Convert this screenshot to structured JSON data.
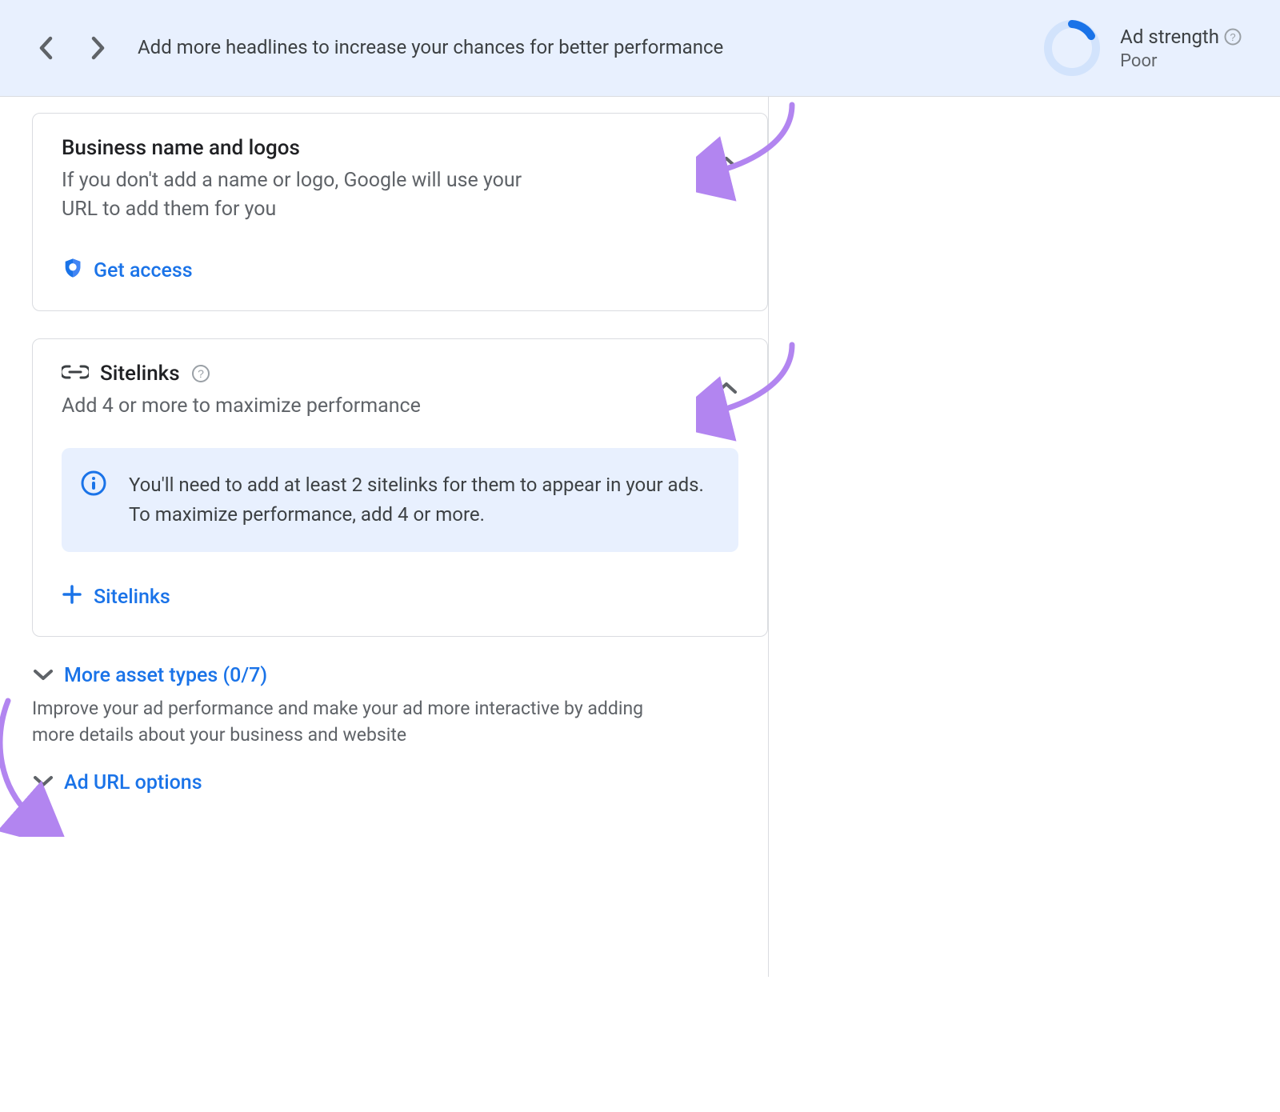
{
  "header": {
    "tip_text": "Add more headlines to increase your chances for better performance",
    "ad_strength_label": "Ad strength",
    "ad_strength_value": "Poor"
  },
  "card_business": {
    "title": "Business name and logos",
    "subtitle": "If you don't add a name or logo, Google will use your URL to add them for you",
    "get_access_label": "Get access"
  },
  "card_sitelinks": {
    "title": "Sitelinks",
    "subtitle": "Add 4 or more to maximize performance",
    "info_text": "You'll need to add at least 2 sitelinks for them to appear in your ads. To maximize performance, add 4 or more.",
    "add_label": "Sitelinks"
  },
  "more_asset_types": {
    "label": "More asset types (0/7)",
    "description": "Improve your ad performance and make your ad more interactive by adding more details about your business and website"
  },
  "ad_url_options": {
    "label": "Ad URL options"
  }
}
